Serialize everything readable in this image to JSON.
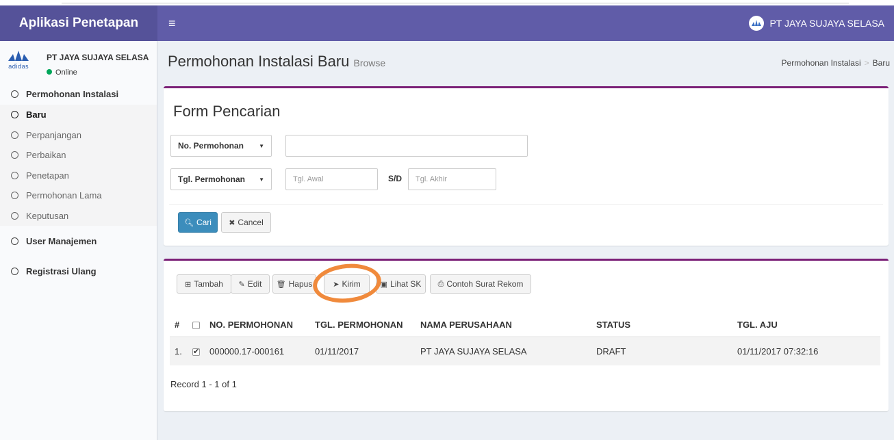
{
  "app": {
    "brand": "Aplikasi Penetapan",
    "nav_user": "PT JAYA SUJAYA SELASA"
  },
  "colors": {
    "navbar": "#605ca8",
    "brand_bg": "#555299",
    "accent_border": "#7b2077",
    "primary": "#3c8dbc",
    "online": "#00a65a",
    "annotation": "#f08a3c"
  },
  "sidebar": {
    "user_name": "PT JAYA SUJAYA SELASA",
    "status": "Online",
    "menu": {
      "permohonan": "Permohonan Instalasi",
      "sub": [
        "Baru",
        "Perpanjangan",
        "Perbaikan",
        "Penetapan",
        "Permohonan Lama",
        "Keputusan"
      ],
      "user_manajemen": "User Manajemen",
      "registrasi": "Registrasi Ulang"
    }
  },
  "header": {
    "title": "Permohonan Instalasi Baru",
    "subtitle": "Browse",
    "breadcrumb": [
      "Permohonan Instalasi",
      "Baru"
    ]
  },
  "search_form": {
    "title": "Form Pencarian",
    "field1_select": "No. Permohonan",
    "field1_value": "",
    "field2_select": "Tgl. Permohonan",
    "date_from_placeholder": "Tgl. Awal",
    "sd_label": "S/D",
    "date_to_placeholder": "Tgl. Akhir",
    "search_button": "Cari",
    "cancel_button": "Cancel"
  },
  "toolbar": {
    "tambah": "Tambah",
    "edit": "Edit",
    "hapus": "Hapus",
    "kirim": "Kirim",
    "lihat_sk": "Lihat SK",
    "contoh": "Contoh Surat Rekom"
  },
  "table": {
    "headers": [
      "#",
      "",
      "NO. PERMOHONAN",
      "TGL. PERMOHONAN",
      "NAMA PERUSAHAAN",
      "STATUS",
      "TGL. AJU"
    ],
    "rows": [
      {
        "no": "1.",
        "checked": true,
        "no_permohonan": "000000.17-000161",
        "tgl": "01/11/2017",
        "nama": "PT JAYA SUJAYA SELASA",
        "status": "DRAFT",
        "tgl_aju": "01/11/2017 07:32:16"
      }
    ],
    "record_text": "Record 1 - 1 of 1"
  }
}
